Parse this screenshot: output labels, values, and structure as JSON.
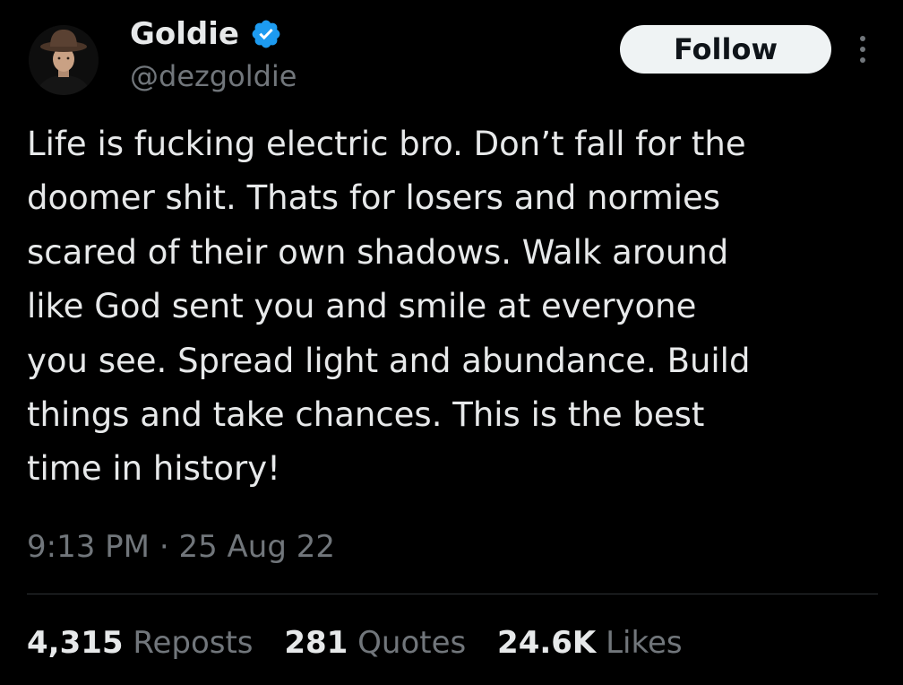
{
  "author": {
    "name": "Goldie",
    "handle": "@dezgoldie",
    "verified": true,
    "avatar_icon": "user-avatar-cowboy-hat"
  },
  "follow_label": "Follow",
  "more_icon": "more-vertical-icon",
  "tweet": {
    "lines": [
      "Life is fucking electric bro. Don’t fall for the",
      "doomer shit. Thats for losers and normies",
      "scared of their own shadows. Walk around",
      "like God sent you and smile at everyone",
      "you see. Spread light and abundance. Build",
      "things and take chances. This is the best",
      "time in history!"
    ],
    "time": "9:13 PM",
    "separator": "·",
    "date": "25 Aug 22"
  },
  "stats": {
    "reposts": {
      "count": "4,315",
      "label": "Reposts"
    },
    "quotes": {
      "count": "281",
      "label": "Quotes"
    },
    "likes": {
      "count": "24.6K",
      "label": "Likes"
    }
  },
  "colors": {
    "background": "#000000",
    "text_primary": "#e7e9ea",
    "text_secondary": "#71767b",
    "verified_blue": "#1d9bf0",
    "follow_bg": "#eff3f4",
    "divider": "#2f3336"
  }
}
